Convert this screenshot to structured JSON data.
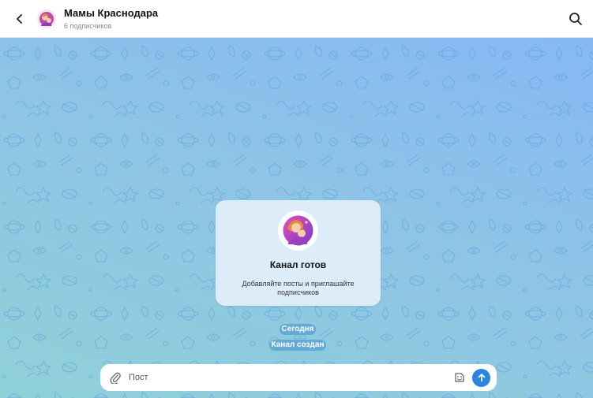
{
  "header": {
    "back_icon": "chevron-left-icon",
    "channel_name": "Мамы Краснодара",
    "subscribers": "6 подписчиков",
    "search_icon": "search-icon"
  },
  "chat": {
    "pattern": "telegram-space-doodles",
    "card": {
      "title": "Канал готов",
      "description": "Добавляйте посты и приглашайте подписчиков"
    },
    "date_pill": "Сегодня",
    "service_message": "Канал создан"
  },
  "composer": {
    "placeholder": "Пост",
    "attach_icon": "paperclip-icon",
    "sticker_icon": "sticker-icon",
    "send_icon": "arrow-up-icon"
  },
  "colors": {
    "accent": "#2a84e0",
    "background_top": "#86b8f4",
    "background_bottom": "#8fd0d8",
    "pill": "#5ca6d2"
  }
}
